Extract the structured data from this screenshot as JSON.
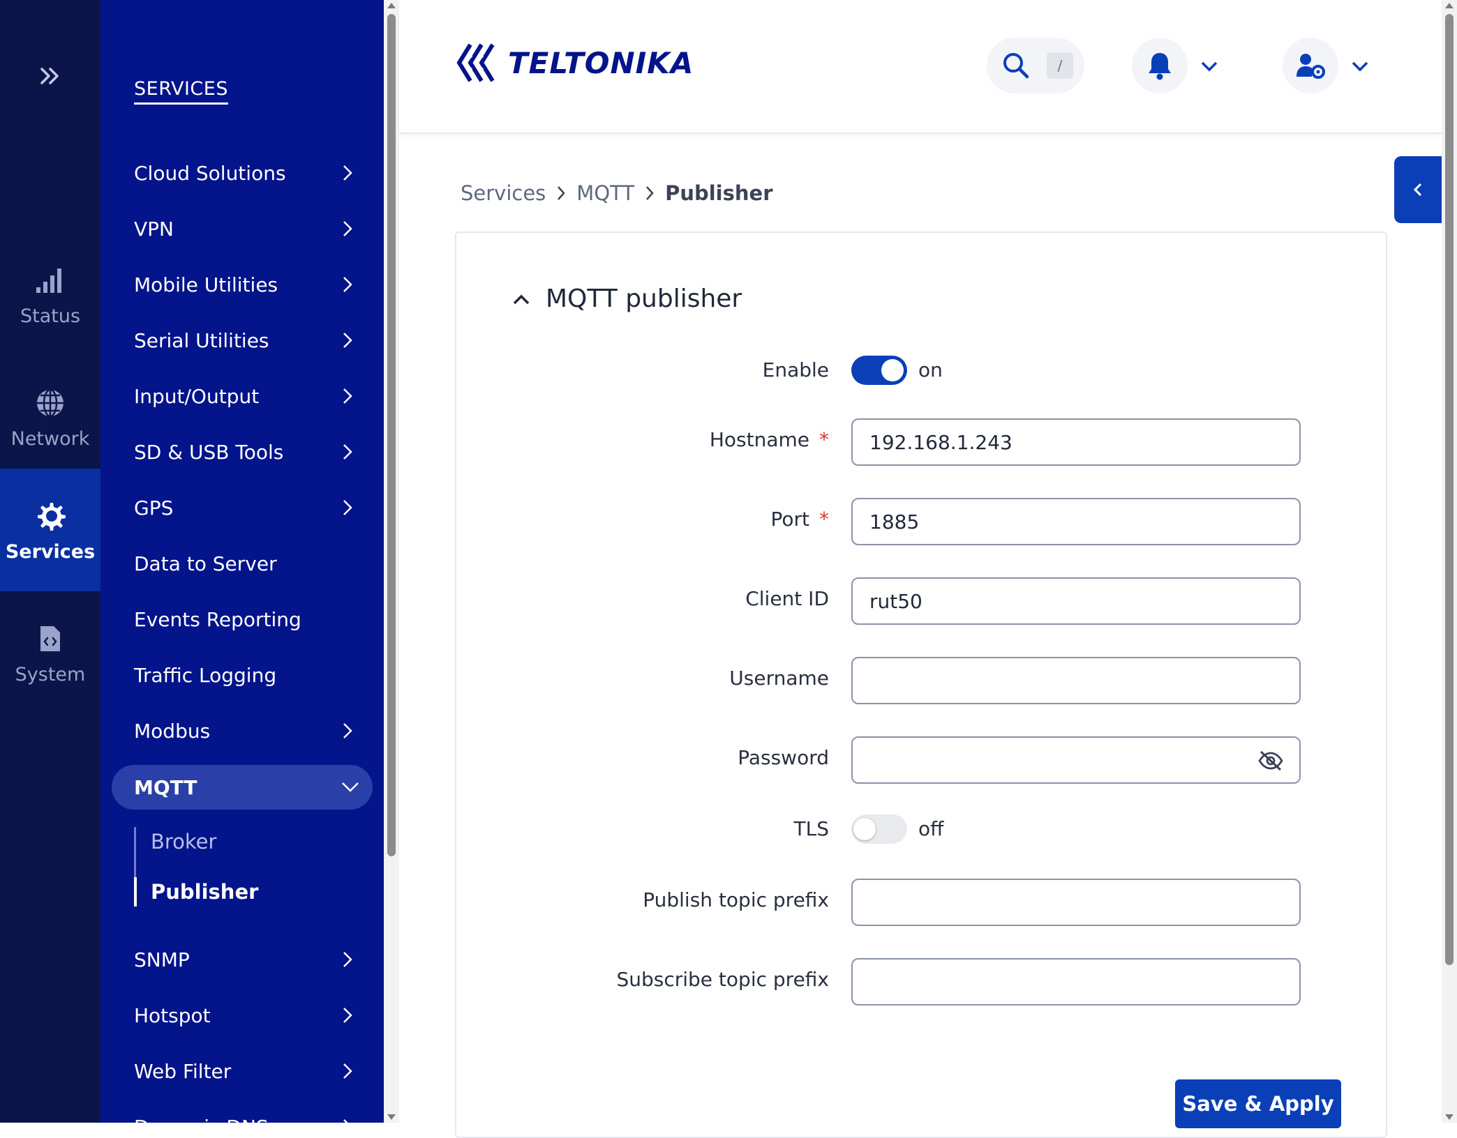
{
  "rail": {
    "items": [
      {
        "label": "Status",
        "icon": "signal-bars-icon"
      },
      {
        "label": "Network",
        "icon": "globe-icon"
      },
      {
        "label": "Services",
        "icon": "gear-icon",
        "active": true
      },
      {
        "label": "System",
        "icon": "file-code-icon"
      }
    ]
  },
  "menu": {
    "title": "SERVICES",
    "items": [
      {
        "label": "Cloud Solutions",
        "has_children": true
      },
      {
        "label": "VPN",
        "has_children": true
      },
      {
        "label": "Mobile Utilities",
        "has_children": true
      },
      {
        "label": "Serial Utilities",
        "has_children": true
      },
      {
        "label": "Input/Output",
        "has_children": true
      },
      {
        "label": "SD & USB Tools",
        "has_children": true
      },
      {
        "label": "GPS",
        "has_children": true
      },
      {
        "label": "Data to Server",
        "has_children": false
      },
      {
        "label": "Events Reporting",
        "has_children": false
      },
      {
        "label": "Traffic Logging",
        "has_children": false
      },
      {
        "label": "Modbus",
        "has_children": true
      },
      {
        "label": "MQTT",
        "has_children": true,
        "expanded": true
      },
      {
        "label": "SNMP",
        "has_children": true
      },
      {
        "label": "Hotspot",
        "has_children": true
      },
      {
        "label": "Web Filter",
        "has_children": true
      },
      {
        "label": "Dynamic DNS",
        "has_children": true
      }
    ],
    "mqtt_sub": [
      {
        "label": "Broker",
        "active": false
      },
      {
        "label": "Publisher",
        "active": true
      }
    ]
  },
  "header": {
    "logo_text": "TELTONIKA",
    "search_shortcut": "/"
  },
  "breadcrumb": [
    "Services",
    "MQTT",
    "Publisher"
  ],
  "form": {
    "title": "MQTT publisher",
    "enable": {
      "label": "Enable",
      "state": "on"
    },
    "hostname": {
      "label": "Hostname",
      "value": "192.168.1.243",
      "required": "*"
    },
    "port": {
      "label": "Port",
      "value": "1885",
      "required": "*"
    },
    "client_id": {
      "label": "Client ID",
      "value": "rut50"
    },
    "username": {
      "label": "Username",
      "value": ""
    },
    "password": {
      "label": "Password",
      "value": ""
    },
    "tls": {
      "label": "TLS",
      "state": "off"
    },
    "publish_prefix": {
      "label": "Publish topic prefix",
      "value": ""
    },
    "subscribe_prefix": {
      "label": "Subscribe topic prefix",
      "value": ""
    },
    "save_label": "Save & Apply"
  },
  "colors": {
    "rail_bg": "#0c1549",
    "menu_bg": "#04148a",
    "accent": "#0a3fb8",
    "required": "#d9382f"
  }
}
